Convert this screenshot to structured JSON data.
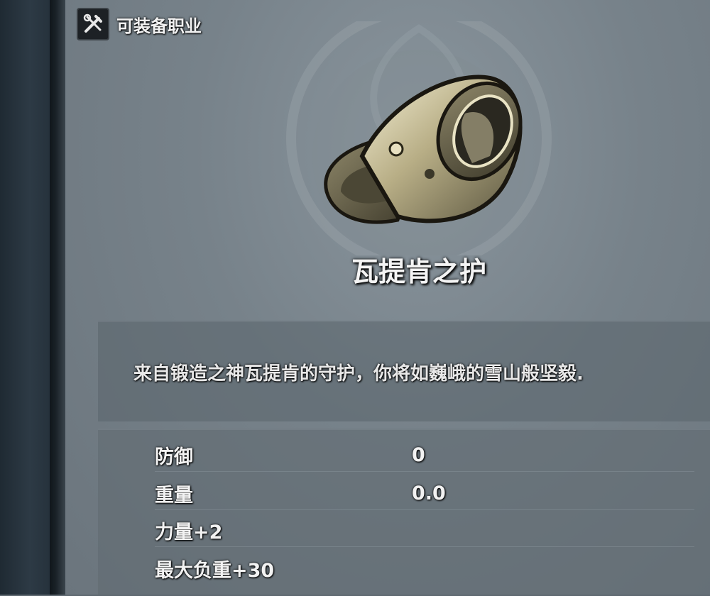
{
  "header": {
    "label": "可装备职业",
    "icon": "crossed-tools-icon"
  },
  "item": {
    "name": "瓦提肯之护",
    "icon": "ring-icon",
    "description": "来自锻造之神瓦提肯的守护，你将如巍峨的雪山般坚毅."
  },
  "stats": [
    {
      "name": "防御",
      "value": "0"
    },
    {
      "name": "重量",
      "value": "0.0"
    }
  ],
  "bonuses": [
    "力量+2",
    "最大负重+30"
  ],
  "colors": {
    "panel": "#77828a",
    "text": "#f2f2f2",
    "ring_metal": "#c9c3a6"
  }
}
